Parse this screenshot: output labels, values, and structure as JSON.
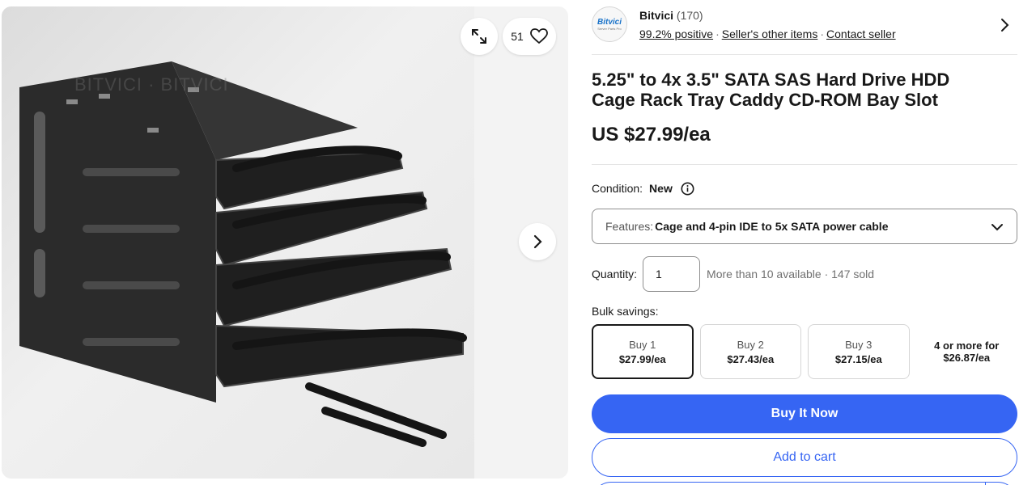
{
  "gallery": {
    "watermark": "BITVICI · BITVICI",
    "watch_count": "51",
    "icons": {
      "expand": "expand-icon",
      "watch": "heart-icon",
      "next": "chevron-right-icon"
    }
  },
  "seller": {
    "logo_text": "Bitvici",
    "logo_subtext": "Server Parts Pro",
    "name": "Bitvici",
    "count": "(170)",
    "positive": "99.2% positive",
    "other_items": "Seller's other items",
    "contact": "Contact seller"
  },
  "listing": {
    "title": "5.25\" to 4x 3.5\" SATA SAS Hard Drive HDD Cage Rack Tray Caddy CD-ROM Bay Slot",
    "price": "US $27.99/ea",
    "condition_label": "Condition:",
    "condition_value": "New",
    "features_label": "Features:",
    "features_value": "Cage and 4-pin IDE to 5x SATA power cable",
    "quantity_label": "Quantity:",
    "quantity_value": "1",
    "availability": "More than 10 available · 147 sold",
    "bulk_label": "Bulk savings:",
    "bulk_tiers": [
      {
        "qty": "Buy 1",
        "price": "$27.99/ea"
      },
      {
        "qty": "Buy 2",
        "price": "$27.43/ea"
      },
      {
        "qty": "Buy 3",
        "price": "$27.15/ea"
      }
    ],
    "bulk_last": {
      "qty": "4 or more for",
      "price": "$26.87/ea"
    }
  },
  "actions": {
    "buy_now": "Buy It Now",
    "add_to_cart": "Add to cart"
  },
  "colors": {
    "accent": "#3665f3",
    "text": "#191919",
    "muted": "#707070"
  }
}
